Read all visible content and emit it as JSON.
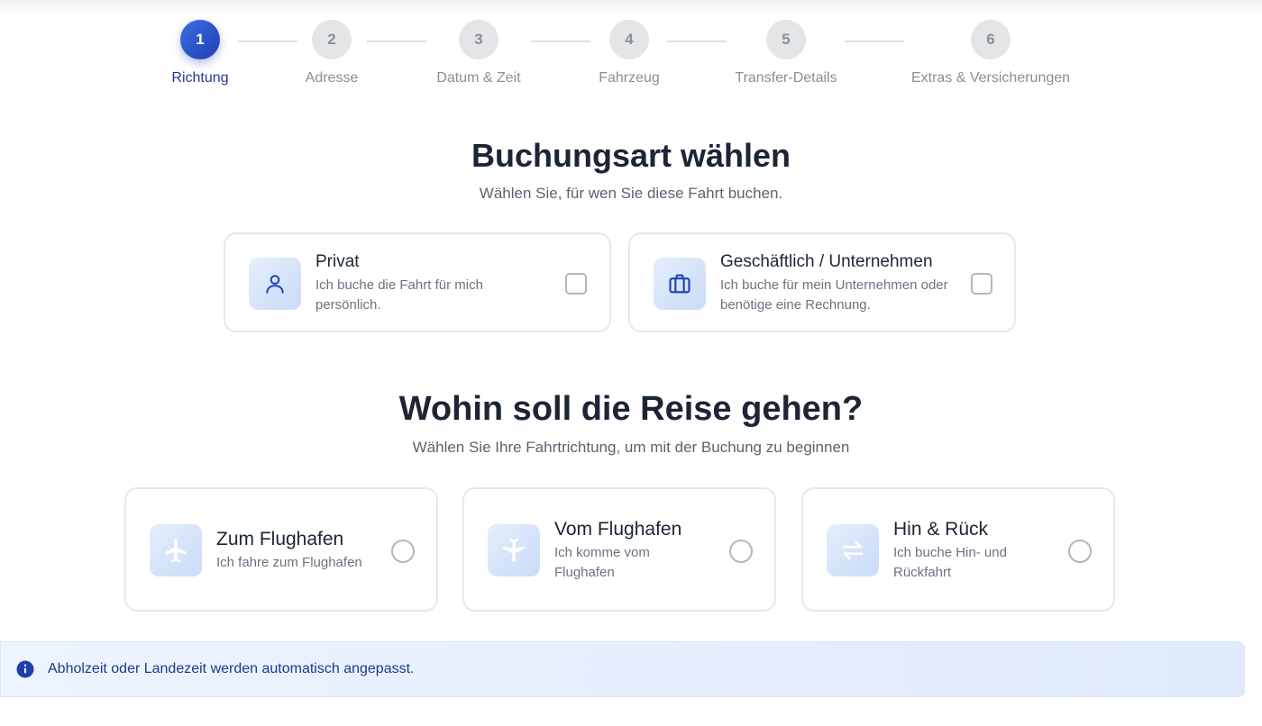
{
  "stepper": {
    "steps": [
      {
        "number": "1",
        "label": "Richtung"
      },
      {
        "number": "2",
        "label": "Adresse"
      },
      {
        "number": "3",
        "label": "Datum & Zeit"
      },
      {
        "number": "4",
        "label": "Fahrzeug"
      },
      {
        "number": "5",
        "label": "Transfer-Details"
      },
      {
        "number": "6",
        "label": "Extras & Versicherungen"
      }
    ],
    "active_step": 1
  },
  "booking_type": {
    "title": "Buchungsart wählen",
    "subtitle": "Wählen Sie, für wen Sie diese Fahrt buchen.",
    "options": [
      {
        "title": "Privat",
        "description": "Ich buche die Fahrt für mich persönlich.",
        "icon": "user-icon",
        "checked": false
      },
      {
        "title": "Geschäftlich / Unternehmen",
        "description": "Ich buche für mein Unternehmen oder benötige eine Rechnung.",
        "icon": "briefcase-icon",
        "checked": false
      }
    ]
  },
  "direction": {
    "title": "Wohin soll die Reise gehen?",
    "subtitle": "Wählen Sie Ihre Fahrtrichtung, um mit der Buchung zu beginnen",
    "options": [
      {
        "title": "Zum Flughafen",
        "description": "Ich fahre zum Flughafen",
        "icon": "plane-departure-icon",
        "selected": false
      },
      {
        "title": "Vom Flughafen",
        "description": "Ich komme vom Flughafen",
        "icon": "plane-arrival-icon",
        "selected": false
      },
      {
        "title": "Hin & Rück",
        "description": "Ich buche Hin- und Rückfahrt",
        "icon": "round-trip-icon",
        "selected": false
      }
    ]
  },
  "info": {
    "text": "Abholzeit oder Landezeit werden automatisch angepasst.",
    "icon": "info-icon"
  },
  "colors": {
    "primary": "#1e40af",
    "accent_gradient_start": "#3b6ee8",
    "icon_bg": "#dbe7fb",
    "info_bg": "#e6effd"
  }
}
